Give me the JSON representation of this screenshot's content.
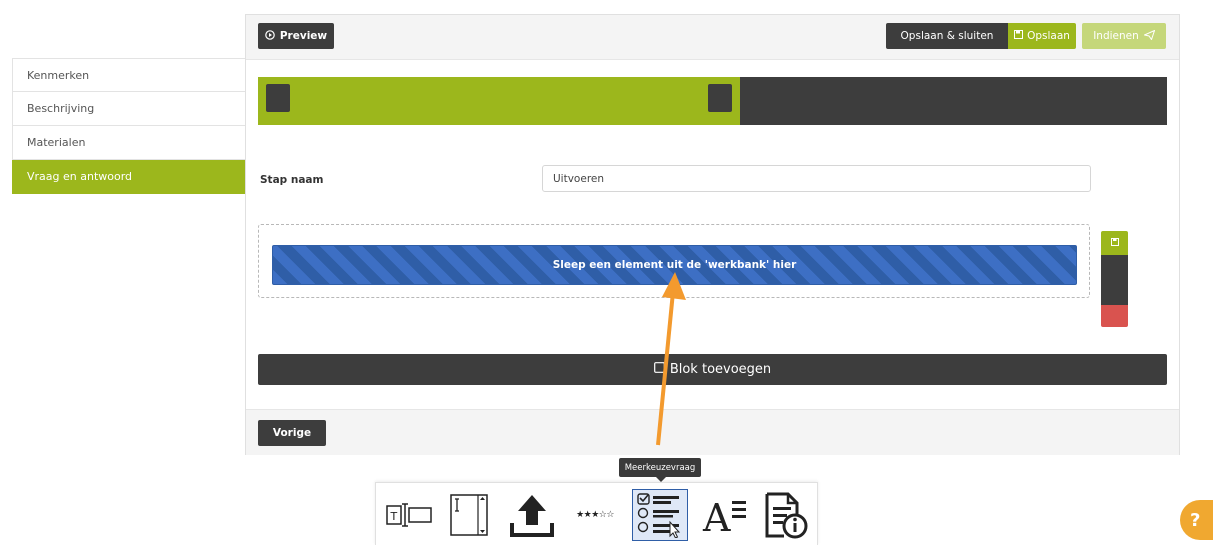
{
  "sidebar": {
    "items": [
      {
        "label": "Kenmerken"
      },
      {
        "label": "Beschrijving"
      },
      {
        "label": "Materialen"
      },
      {
        "label": "Vraag en antwoord"
      }
    ]
  },
  "toolbar": {
    "preview_label": "Preview",
    "save_close_label": "Opslaan & sluiten",
    "save_label": "Opslaan",
    "submit_label": "Indienen"
  },
  "progress": {
    "fraction": 0.53
  },
  "step": {
    "name_label": "Stap naam",
    "name_value": "Uitvoeren"
  },
  "dropzone": {
    "text": "Sleep een element uit de 'werkbank' hier"
  },
  "add_block_label": "Blok toevoegen",
  "footer": {
    "prev_label": "Vorige"
  },
  "tooltip": {
    "text": "Meerkeuzevraag"
  },
  "workbench": {
    "tools": [
      {
        "icon": "text-input-icon"
      },
      {
        "icon": "textarea-icon"
      },
      {
        "icon": "upload-icon"
      },
      {
        "icon": "rating-stars-icon",
        "text": "★★★☆☆"
      },
      {
        "icon": "multiple-choice-icon"
      },
      {
        "icon": "text-format-icon"
      },
      {
        "icon": "document-info-icon"
      }
    ]
  },
  "help": {
    "label": "?"
  },
  "colors": {
    "accent": "#9cb71c",
    "dark": "#3d3d3d",
    "danger": "#d9534f",
    "dropzone_blue": "#3d6fc4",
    "arrow": "#f39a2e",
    "help": "#f0a830"
  }
}
